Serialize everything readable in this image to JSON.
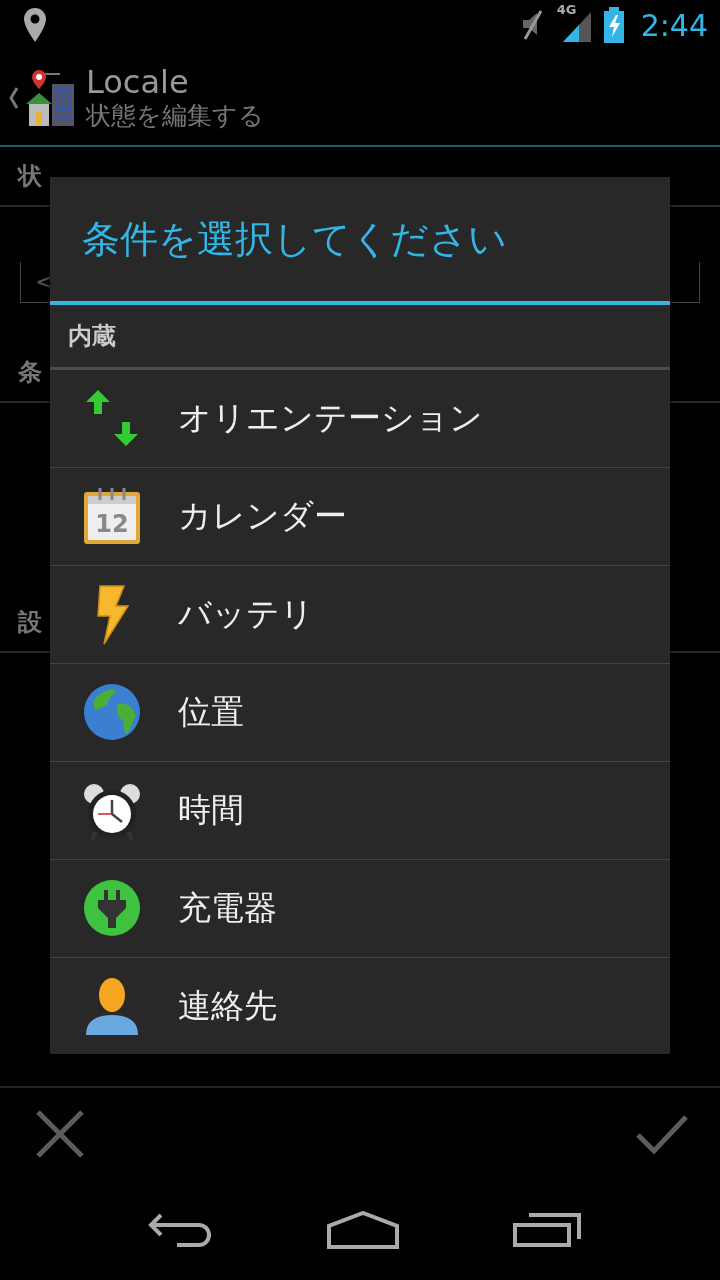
{
  "status_bar": {
    "network": "4G",
    "time": "2:44"
  },
  "action_bar": {
    "title": "Locale",
    "subtitle": "状態を編集する"
  },
  "form": {
    "name_label": "状",
    "name_value": "<",
    "conditions_label": "条",
    "settings_label": "設"
  },
  "dialog": {
    "title": "条件を選択してください",
    "section": "内蔵",
    "items": [
      {
        "label": "オリエンテーション"
      },
      {
        "label": "カレンダー",
        "icon_label": "12"
      },
      {
        "label": "バッテリ"
      },
      {
        "label": "位置"
      },
      {
        "label": "時間"
      },
      {
        "label": "充電器"
      },
      {
        "label": "連絡先"
      }
    ]
  }
}
